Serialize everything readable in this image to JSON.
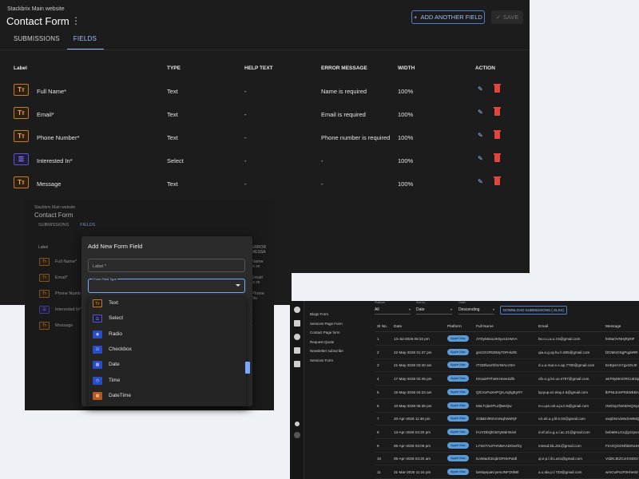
{
  "form_editor": {
    "subtitle": "Stackbrix Main website",
    "title": "Contact Form",
    "add_button": "ADD ANOTHER FIELD",
    "save_button": "SAVE",
    "tabs": [
      "SUBMISSIONS",
      "FIELDS"
    ],
    "active_tab": "FIELDS",
    "columns": [
      "Label",
      "TYPE",
      "HELP TEXT",
      "ERROR MESSAGE",
      "WIDTH",
      "ACTION"
    ],
    "rows": [
      {
        "icon": "text-field-icon",
        "icon_glyph": "Tт",
        "label": "Full Name*",
        "type": "Text",
        "help": "-",
        "error": "Name is required",
        "width": "100%"
      },
      {
        "icon": "text-field-icon",
        "icon_glyph": "Tт",
        "label": "Email*",
        "type": "Text",
        "help": "-",
        "error": "Email is required",
        "width": "100%"
      },
      {
        "icon": "text-field-icon",
        "icon_glyph": "Tт",
        "label": "Phone Number*",
        "type": "Text",
        "help": "-",
        "error": "Phone number is required",
        "width": "100%"
      },
      {
        "icon": "list-field-icon",
        "icon_glyph": "☰",
        "label": "Interested In*",
        "type": "Select",
        "help": "-",
        "error": "-",
        "width": "100%"
      },
      {
        "icon": "text-field-icon",
        "icon_glyph": "Tт",
        "label": "Message",
        "type": "Text",
        "help": "-",
        "error": "-",
        "width": "100%"
      }
    ]
  },
  "modal_view": {
    "bg_subtitle": "Stackbrix Main website",
    "bg_title": "Contact Form",
    "bg_tabs": [
      "SUBMISSIONS",
      "FIELDS"
    ],
    "bg_label_header": "Label",
    "bg_rows": [
      {
        "label": "Full Name*",
        "error": "Name is re"
      },
      {
        "label": "Email*",
        "error": "Email is re"
      },
      {
        "label": "Phone Numb",
        "error": "Phone Nu"
      },
      {
        "label": "Interested In*",
        "error": "-"
      },
      {
        "label": "Message",
        "error": "-"
      }
    ],
    "bg_error_header": "ERROR MESSA",
    "modal_title": "Add New Form Field",
    "label_placeholder": "Label *",
    "field_type_label": "Form Field Type",
    "options": [
      {
        "label": "Text",
        "icon": "text-field-icon",
        "glyph": "Tт"
      },
      {
        "label": "Select",
        "icon": "list-field-icon",
        "glyph": "☰"
      },
      {
        "label": "Radio",
        "icon": "radio-icon",
        "glyph": "◉"
      },
      {
        "label": "Checkbox",
        "icon": "checkbox-icon",
        "glyph": "☑"
      },
      {
        "label": "Date",
        "icon": "date-icon",
        "glyph": "▦"
      },
      {
        "label": "Time",
        "icon": "time-icon",
        "glyph": "◷"
      },
      {
        "label": "DateTime",
        "icon": "datetime-icon",
        "glyph": "▦"
      }
    ]
  },
  "submissions_view": {
    "nav_items": [
      "Blogs Form",
      "Services Page Form",
      "Contact Page form",
      "Request Quote",
      "Newsletter subscribe",
      "Services Form"
    ],
    "filters": [
      {
        "caption": "Platform",
        "value": "All"
      },
      {
        "caption": "Sort by",
        "value": "Date"
      },
      {
        "caption": "Order",
        "value": "Descending"
      }
    ],
    "download_button": "DOWNLOAD SUBMISSIONS (.XLSX)",
    "columns": [
      "Sl No.",
      "Date",
      "Platform",
      "Full Name",
      "Email",
      "Message"
    ],
    "rows": [
      {
        "n": "1",
        "date": "13-Jul-2026 08:32 pm",
        "platform": "Apple Mac",
        "name": "JYDyMosoJK0yxUUWAA",
        "email": "bo.o.u.a.u.t.5@gmail.com",
        "msg": "fe/8aOVNHjRpNF"
      },
      {
        "n": "2",
        "date": "22-May-2026 01:37 pm",
        "platform": "Apple Mac",
        "name": "gnGOGR5DMyT0FHkzlE",
        "email": "qia.a.g.ay.hu.h.605@gmail.com",
        "msg": "fZOMnOSgPqpbRR"
      },
      {
        "n": "3",
        "date": "21-May-2026 03:40 am",
        "platform": "Apple Mac",
        "name": "rTGDfwozhfmrWALVSH",
        "email": "d.u.a.mar.e.e.ap.7706@gmail.com",
        "msg": "EeEpsAXYgxGNJK"
      },
      {
        "n": "4",
        "date": "17-May-2026 02:46 pm",
        "platform": "Apple Mac",
        "name": "KKaoiIFFhetKHneeZZlk",
        "email": "ofo.o.g.kn.uo.s787@gmail.com",
        "msg": "aKF8yMmORCoESpM"
      },
      {
        "n": "5",
        "date": "15-May-2026 04:23 am",
        "platform": "Apple Mac",
        "name": "QlCXxPaXHPQrLAqhgEyRY",
        "email": "lqcyup.ez.elay.4.6@gmail.com",
        "msg": "lbPNLEmPRdWEBAL"
      },
      {
        "n": "6",
        "date": "10-May-2026 05:36 pm",
        "platform": "Apple Mac",
        "name": "MsLTqlaXPLefjNsIQw",
        "email": "m.u.pe.cel.a.ja.0.6@gmail.com",
        "msg": "rNrDsyzhsNDNQXyZ"
      },
      {
        "n": "7",
        "date": "20-Apr-2026 11:46 pm",
        "platform": "Apple Mac",
        "name": "zOBDnlRSVmNqhWsRjF",
        "email": "v.k.ek.a.y.lil.6.02@gmail.com",
        "msg": "xwpbNAdvNdAWMQ"
      },
      {
        "n": "8",
        "date": "13-Apr-2026 04:20 pm",
        "platform": "Apple Mac",
        "name": "fAzVDbQlGkOyMdrWJel",
        "email": "d.ef.af.u.g.u.l.ac.21@gmail.com",
        "msg": "bebMiKLGLIjlyzzpvn"
      },
      {
        "n": "9",
        "date": "06-Apr-2026 03:06 pm",
        "platform": "Apple Mac",
        "name": "LYSKTAUFHNMAADOwrfzy",
        "email": "msssd.ktLJ31@gmail.com",
        "msg": "FtAXQGDNhbDNUHK"
      },
      {
        "n": "10",
        "date": "05-Apr-2026 04:20 am",
        "platform": "Apple Mac",
        "name": "tUvMadCEqbrOFKkPutdl",
        "email": "qi.e.p.l.ili.Lu61@gmail.com",
        "msg": "VdZKJEZCvIXSDGr"
      },
      {
        "n": "11",
        "date": "31-Mar-2026 11:24 pm",
        "platform": "Apple Mac",
        "name": "beMqepaKryemJNFO0kBl",
        "email": "a.u.ida.p.l.733@gmail.com",
        "msg": "wmCwPv2F0Hhe0d"
      }
    ]
  },
  "colors": {
    "accent": "#9cc0ff",
    "delete": "#e0463e",
    "text_icon": "#f0a346",
    "list_icon": "#8a85ff",
    "badge": "#5b9bd8"
  }
}
